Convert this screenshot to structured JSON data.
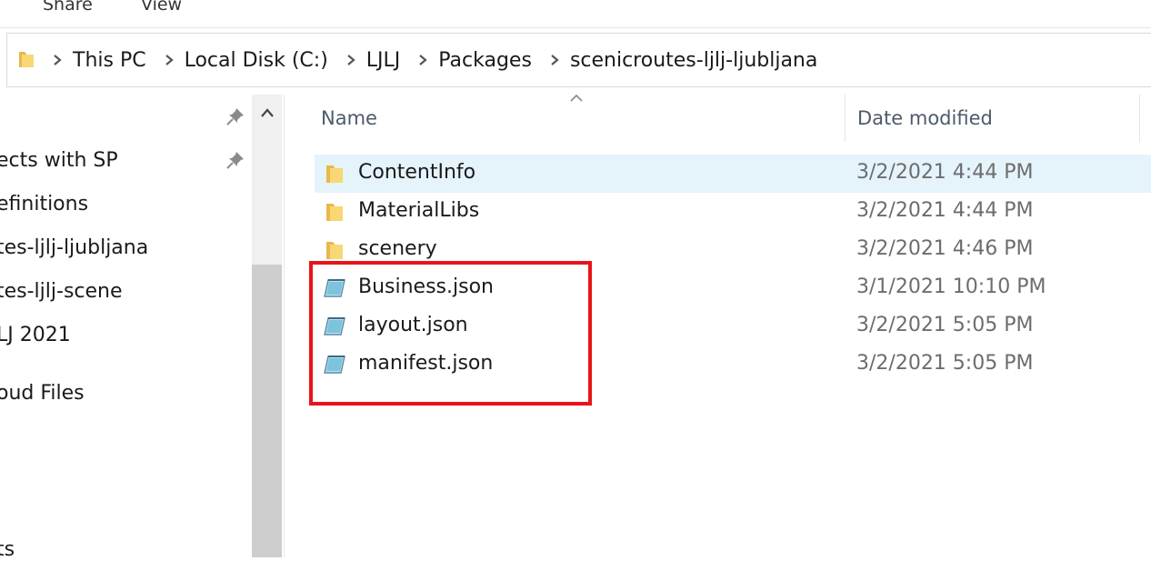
{
  "ribbon": {
    "tabs": [
      "Share",
      "View"
    ]
  },
  "address": {
    "breadcrumbs": [
      "This PC",
      "Local Disk (C:)",
      "LJLJ",
      "Packages",
      "scenicroutes-ljlj-ljubljana"
    ]
  },
  "nav": {
    "items": [
      "ects with SP",
      "efinitions",
      "tes-ljlj-ljubljana",
      "tes-ljlj-scene",
      "LJ 2021",
      "oud Files",
      "ts"
    ]
  },
  "columns": {
    "name": "Name",
    "date": "Date modified"
  },
  "files": [
    {
      "name": "ContentInfo",
      "date": "3/2/2021 4:44 PM",
      "type": "folder"
    },
    {
      "name": "MaterialLibs",
      "date": "3/2/2021 4:44 PM",
      "type": "folder"
    },
    {
      "name": "scenery",
      "date": "3/2/2021 4:46 PM",
      "type": "folder"
    },
    {
      "name": "Business.json",
      "date": "3/1/2021 10:10 PM",
      "type": "json"
    },
    {
      "name": "layout.json",
      "date": "3/2/2021 5:05 PM",
      "type": "json"
    },
    {
      "name": "manifest.json",
      "date": "3/2/2021 5:05 PM",
      "type": "json"
    }
  ],
  "colors": {
    "selected_row": "#e5f3fb",
    "highlight": "#e8141b",
    "folder": "#f8d775"
  }
}
